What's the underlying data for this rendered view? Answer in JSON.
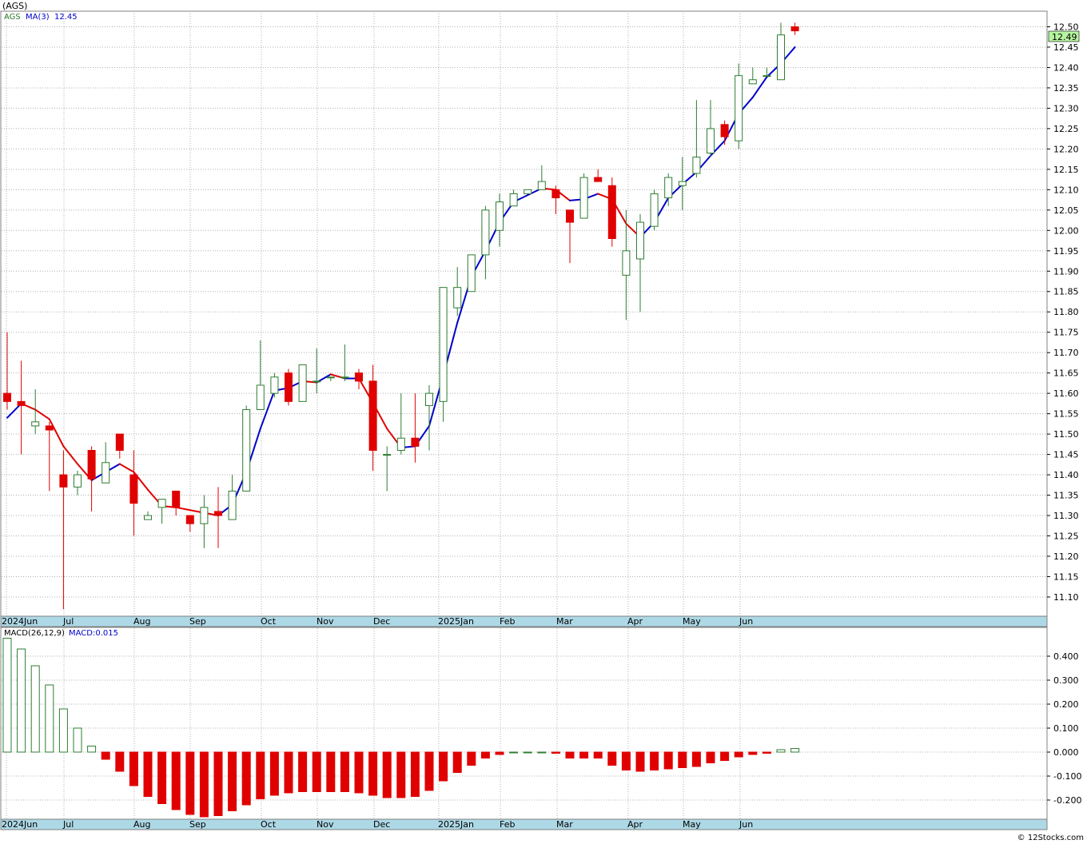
{
  "title": "(AGS)",
  "credit": "© 12Stocks.com",
  "colors": {
    "up_candle": "#2e7d32",
    "down_candle": "#e00000",
    "ma_rising": "#0000cc",
    "ma_falling": "#e00000",
    "grid": "#b0b0b0",
    "axis_band": "#add8e6",
    "price_tag_bg": "#b6f5a0"
  },
  "legend": {
    "symbol": "AGS",
    "ma_label": "MA(3)",
    "ma_value": "12.45",
    "macd_label": "MACD(26,12,9)",
    "macd_value": "MACD:0.015"
  },
  "last_price_label": "12.49",
  "chart_data": [
    {
      "type": "candlestick",
      "name": "price",
      "ylim": [
        11.06,
        12.53
      ],
      "yticks": [
        "12.50",
        "12.45",
        "12.40",
        "12.35",
        "12.30",
        "12.25",
        "12.20",
        "12.15",
        "12.10",
        "12.05",
        "12.00",
        "11.95",
        "11.90",
        "11.85",
        "11.80",
        "11.75",
        "11.70",
        "11.65",
        "11.60",
        "11.55",
        "11.50",
        "11.45",
        "11.40",
        "11.35",
        "11.30",
        "11.25",
        "11.20",
        "11.15",
        "11.10"
      ],
      "xticks": [
        "2024Jun",
        "Jul",
        "Aug",
        "Sep",
        "Oct",
        "Nov",
        "Dec",
        "2025Jan",
        "Feb",
        "Mar",
        "Apr",
        "May",
        "Jun"
      ],
      "grid": true,
      "ma_period": 3,
      "candles": [
        {
          "o": 11.6,
          "h": 11.75,
          "l": 11.56,
          "c": 11.58
        },
        {
          "o": 11.58,
          "h": 11.68,
          "l": 11.45,
          "c": 11.57
        },
        {
          "o": 11.52,
          "h": 11.61,
          "l": 11.5,
          "c": 11.53
        },
        {
          "o": 11.52,
          "h": 11.53,
          "l": 11.36,
          "c": 11.51
        },
        {
          "o": 11.4,
          "h": 11.46,
          "l": 11.07,
          "c": 11.37
        },
        {
          "o": 11.37,
          "h": 11.41,
          "l": 11.35,
          "c": 11.4
        },
        {
          "o": 11.46,
          "h": 11.47,
          "l": 11.31,
          "c": 11.39
        },
        {
          "o": 11.38,
          "h": 11.48,
          "l": 11.38,
          "c": 11.43
        },
        {
          "o": 11.5,
          "h": 11.5,
          "l": 11.44,
          "c": 11.46
        },
        {
          "o": 11.4,
          "h": 11.46,
          "l": 11.25,
          "c": 11.33
        },
        {
          "o": 11.29,
          "h": 11.31,
          "l": 11.29,
          "c": 11.3
        },
        {
          "o": 11.32,
          "h": 11.34,
          "l": 11.28,
          "c": 11.34
        },
        {
          "o": 11.36,
          "h": 11.36,
          "l": 11.3,
          "c": 11.32
        },
        {
          "o": 11.3,
          "h": 11.3,
          "l": 11.26,
          "c": 11.28
        },
        {
          "o": 11.28,
          "h": 11.35,
          "l": 11.22,
          "c": 11.32
        },
        {
          "o": 11.31,
          "h": 11.37,
          "l": 11.22,
          "c": 11.3
        },
        {
          "o": 11.29,
          "h": 11.4,
          "l": 11.29,
          "c": 11.36
        },
        {
          "o": 11.36,
          "h": 11.57,
          "l": 11.36,
          "c": 11.56
        },
        {
          "o": 11.56,
          "h": 11.73,
          "l": 11.56,
          "c": 11.62
        },
        {
          "o": 11.6,
          "h": 11.65,
          "l": 11.59,
          "c": 11.64
        },
        {
          "o": 11.65,
          "h": 11.66,
          "l": 11.57,
          "c": 11.58
        },
        {
          "o": 11.58,
          "h": 11.67,
          "l": 11.58,
          "c": 11.67
        },
        {
          "o": 11.63,
          "h": 11.71,
          "l": 11.6,
          "c": 11.63
        },
        {
          "o": 11.64,
          "h": 11.64,
          "l": 11.63,
          "c": 11.64
        },
        {
          "o": 11.64,
          "h": 11.72,
          "l": 11.63,
          "c": 11.64
        },
        {
          "o": 11.65,
          "h": 11.66,
          "l": 11.61,
          "c": 11.63
        },
        {
          "o": 11.63,
          "h": 11.67,
          "l": 11.41,
          "c": 11.46
        },
        {
          "o": 11.45,
          "h": 11.47,
          "l": 11.36,
          "c": 11.45
        },
        {
          "o": 11.46,
          "h": 11.6,
          "l": 11.45,
          "c": 11.49
        },
        {
          "o": 11.49,
          "h": 11.6,
          "l": 11.43,
          "c": 11.47
        },
        {
          "o": 11.57,
          "h": 11.62,
          "l": 11.46,
          "c": 11.6
        },
        {
          "o": 11.58,
          "h": 11.86,
          "l": 11.53,
          "c": 11.86
        },
        {
          "o": 11.81,
          "h": 11.91,
          "l": 11.79,
          "c": 11.86
        },
        {
          "o": 11.85,
          "h": 11.94,
          "l": 11.85,
          "c": 11.94
        },
        {
          "o": 11.94,
          "h": 12.06,
          "l": 11.88,
          "c": 12.05
        },
        {
          "o": 12.0,
          "h": 12.09,
          "l": 11.96,
          "c": 12.07
        },
        {
          "o": 12.06,
          "h": 12.1,
          "l": 12.06,
          "c": 12.09
        },
        {
          "o": 12.09,
          "h": 12.1,
          "l": 12.09,
          "c": 12.1
        },
        {
          "o": 12.1,
          "h": 12.16,
          "l": 12.1,
          "c": 12.12
        },
        {
          "o": 12.1,
          "h": 12.11,
          "l": 12.04,
          "c": 12.08
        },
        {
          "o": 12.05,
          "h": 12.05,
          "l": 11.92,
          "c": 12.02
        },
        {
          "o": 12.03,
          "h": 12.14,
          "l": 12.03,
          "c": 12.13
        },
        {
          "o": 12.13,
          "h": 12.15,
          "l": 12.12,
          "c": 12.12
        },
        {
          "o": 12.11,
          "h": 12.13,
          "l": 11.96,
          "c": 11.98
        },
        {
          "o": 11.89,
          "h": 12.05,
          "l": 11.78,
          "c": 11.95
        },
        {
          "o": 11.93,
          "h": 12.04,
          "l": 11.8,
          "c": 12.02
        },
        {
          "o": 12.01,
          "h": 12.1,
          "l": 12.0,
          "c": 12.09
        },
        {
          "o": 12.08,
          "h": 12.14,
          "l": 12.06,
          "c": 12.13
        },
        {
          "o": 12.11,
          "h": 12.18,
          "l": 12.05,
          "c": 12.12
        },
        {
          "o": 12.14,
          "h": 12.32,
          "l": 12.13,
          "c": 12.18
        },
        {
          "o": 12.19,
          "h": 12.32,
          "l": 12.18,
          "c": 12.25
        },
        {
          "o": 12.26,
          "h": 12.27,
          "l": 12.21,
          "c": 12.23
        },
        {
          "o": 12.22,
          "h": 12.41,
          "l": 12.2,
          "c": 12.38
        },
        {
          "o": 12.36,
          "h": 12.4,
          "l": 12.36,
          "c": 12.37
        },
        {
          "o": 12.38,
          "h": 12.4,
          "l": 12.38,
          "c": 12.38
        },
        {
          "o": 12.37,
          "h": 12.51,
          "l": 12.37,
          "c": 12.48
        },
        {
          "o": 12.5,
          "h": 12.51,
          "l": 12.48,
          "c": 12.49
        }
      ]
    },
    {
      "type": "bar",
      "name": "macd",
      "ylim": [
        -0.28,
        0.48
      ],
      "yticks": [
        "0.400",
        "0.300",
        "0.200",
        "0.100",
        "0.000",
        "-0.100",
        "-0.200"
      ],
      "xticks": [
        "2024Jun",
        "Jul",
        "Aug",
        "Sep",
        "Oct",
        "Nov",
        "Dec",
        "2025Jan",
        "Feb",
        "Mar",
        "Apr",
        "May",
        "Jun"
      ],
      "values": [
        0.475,
        0.43,
        0.36,
        0.28,
        0.18,
        0.1,
        0.025,
        -0.03,
        -0.08,
        -0.14,
        -0.185,
        -0.215,
        -0.24,
        -0.26,
        -0.27,
        -0.265,
        -0.245,
        -0.22,
        -0.195,
        -0.18,
        -0.17,
        -0.165,
        -0.165,
        -0.165,
        -0.165,
        -0.17,
        -0.18,
        -0.19,
        -0.19,
        -0.185,
        -0.16,
        -0.12,
        -0.085,
        -0.055,
        -0.025,
        -0.01,
        0.0,
        0.0,
        0.0,
        -0.005,
        -0.025,
        -0.025,
        -0.025,
        -0.055,
        -0.075,
        -0.08,
        -0.075,
        -0.07,
        -0.065,
        -0.06,
        -0.045,
        -0.035,
        -0.02,
        -0.01,
        -0.005,
        0.01,
        0.015
      ]
    }
  ]
}
